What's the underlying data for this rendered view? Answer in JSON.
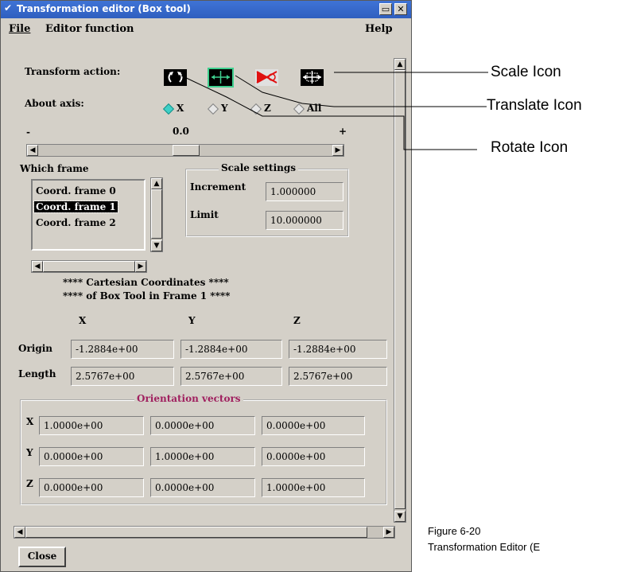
{
  "window": {
    "title": "Transformation editor (Box tool)",
    "menu": {
      "file": "File",
      "editor_function": "Editor function",
      "help": "Help"
    }
  },
  "transform": {
    "action_label": "Transform action:",
    "axis_label": "About axis:",
    "axes": [
      "X",
      "Y",
      "Z",
      "All"
    ],
    "selected_axis": "X",
    "active_action": "translate",
    "slider_min": "-",
    "slider_max": "+",
    "slider_value": "0.0",
    "slider_fraction": 0.5
  },
  "which_frame": {
    "label": "Which frame",
    "items": [
      "Coord. frame 0",
      "Coord. frame 1",
      "Coord. frame 2"
    ],
    "selected": "Coord. frame 1"
  },
  "scale_settings": {
    "title": "Scale settings",
    "increment_label": "Increment",
    "increment_value": "1.000000",
    "limit_label": "Limit",
    "limit_value": "10.000000"
  },
  "coords": {
    "heading_line1": "**** Cartesian Coordinates ****",
    "heading_line2": "**** of Box Tool in Frame 1 ****",
    "col_x": "X",
    "col_y": "Y",
    "col_z": "Z",
    "origin_label": "Origin",
    "origin": [
      "-1.2884e+00",
      "-1.2884e+00",
      "-1.2884e+00"
    ],
    "length_label": "Length",
    "length": [
      "2.5767e+00",
      "2.5767e+00",
      "2.5767e+00"
    ]
  },
  "orientation": {
    "title": "Orientation vectors",
    "title_color": "#a0205f",
    "rows": [
      {
        "label": "X",
        "values": [
          "1.0000e+00",
          "0.0000e+00",
          "0.0000e+00"
        ]
      },
      {
        "label": "Y",
        "values": [
          "0.0000e+00",
          "1.0000e+00",
          "0.0000e+00"
        ]
      },
      {
        "label": "Z",
        "values": [
          "0.0000e+00",
          "0.0000e+00",
          "1.0000e+00"
        ]
      }
    ]
  },
  "close_label": "Close",
  "callouts": {
    "scale": "Scale Icon",
    "translate": "Translate Icon",
    "rotate": "Rotate Icon"
  },
  "caption": {
    "line1": "Figure 6-20",
    "line2": "Transformation Editor (E"
  },
  "icons": {
    "rotate": "rotate-icon",
    "translate": "translate-icon",
    "scale-red": "scale-icon",
    "scale-arrows": "arrows-icon"
  }
}
